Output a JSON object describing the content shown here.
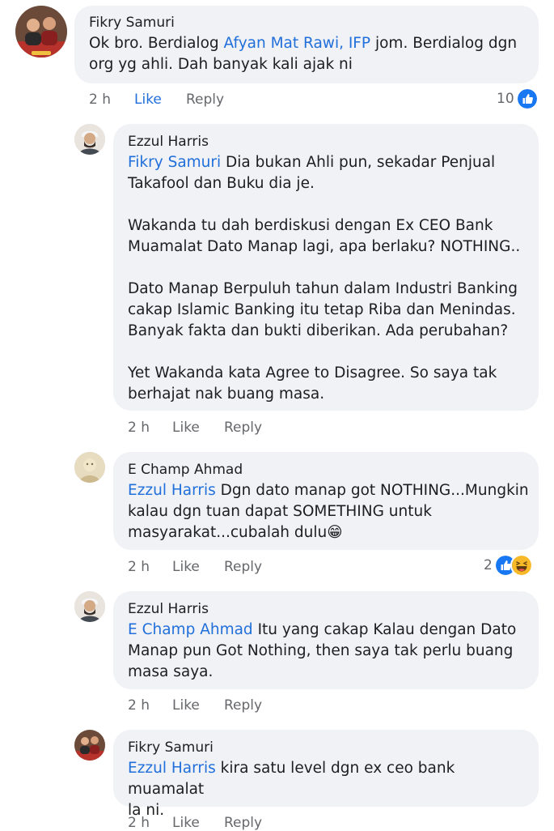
{
  "comments": [
    {
      "author": "Fikry Samuri",
      "mention": "Afyan Mat Rawi, IFP",
      "lines": [
        "Ok bro. Berdialog ",
        " jom. Berdialog dgn",
        "org yg ahli. Dah banyak kali ajak ni"
      ],
      "time": "2 h",
      "like": "Like",
      "reply": "Reply",
      "reaction_count": "10",
      "reactions": [
        "like-icon"
      ]
    },
    {
      "author": "Ezzul Harris",
      "mention": "Fikry Samuri",
      "text_after_mention": " Dia bukan Ahli pun, sekadar Penjual\nTakafool dan Buku dia je.\n\nWakanda tu dah berdiskusi dengan Ex CEO Bank\nMuamalat Dato Manap lagi, apa berlaku? NOTHING..\n\nDato Manap Berpuluh tahun dalam Industri Banking\ncakap Islamic Banking itu tetap Riba dan Menindas.\nBanyak fakta dan bukti diberikan. Ada perubahan?\n\nYet Wakanda kata Agree to Disagree. So saya tak\nberhajat nak buang masa.",
      "time": "2 h",
      "like": "Like",
      "reply": "Reply"
    },
    {
      "author": "E Champ Ahmad",
      "mention": "Ezzul Harris",
      "text_after_mention": " Dgn dato manap got NOTHING...Mungkin\nkalau dgn tuan dapat SOMETHING untuk\nmasyarakat...cubalah dulu😁",
      "time": "2 h",
      "like": "Like",
      "reply": "Reply",
      "reaction_count": "2",
      "reactions": [
        "like-icon",
        "haha-icon"
      ]
    },
    {
      "author": "Ezzul Harris",
      "mention": "E Champ Ahmad",
      "text_after_mention": " Itu yang cakap Kalau dengan Dato\nManap pun Got Nothing, then saya tak perlu buang\nmasa saya.",
      "time": "2 h",
      "like": "Like",
      "reply": "Reply"
    },
    {
      "author": "Fikry Samuri",
      "mention": "Ezzul Harris",
      "text_after_mention": " kira satu level dgn ex ceo bank muamalat\nla ni.",
      "time": "2 h",
      "like": "Like",
      "reply": "Reply"
    }
  ],
  "colors": {
    "bubble": "#f0f2f5",
    "link": "#216fdb",
    "meta": "#65676b",
    "like_blue": "#1877f2",
    "haha_yellow": "#f7b928"
  }
}
